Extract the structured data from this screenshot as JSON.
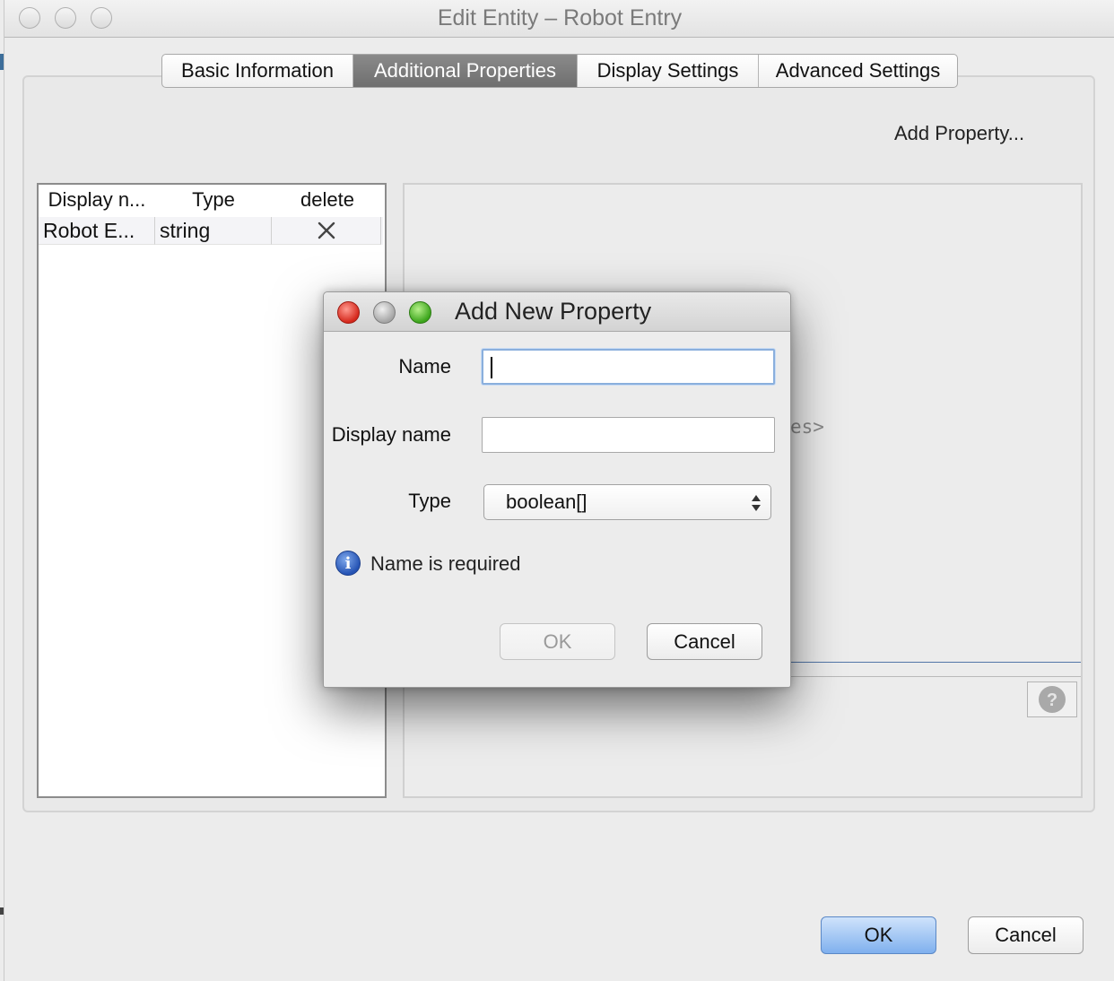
{
  "window": {
    "title": "Edit Entity – Robot Entry"
  },
  "tabs": [
    {
      "label": "Basic Information",
      "active": false
    },
    {
      "label": "Additional Properties",
      "active": true
    },
    {
      "label": "Display Settings",
      "active": false
    },
    {
      "label": "Advanced Settings",
      "active": false
    }
  ],
  "properties_panel": {
    "add_property_label": "Add Property...",
    "columns": [
      "Display n...",
      "Type",
      "delete"
    ],
    "rows": [
      {
        "display_name": "Robot E...",
        "type": "string",
        "delete_icon": "x-icon"
      }
    ],
    "details_hint_fragment": "es>"
  },
  "footer": {
    "ok_label": "OK",
    "cancel_label": "Cancel"
  },
  "dialog": {
    "title": "Add New Property",
    "name_label": "Name",
    "name_value": "",
    "display_name_label": "Display name",
    "display_name_value": "",
    "type_label": "Type",
    "type_value": "boolean[]",
    "message": "Name is required",
    "ok_label": "OK",
    "ok_enabled": false,
    "cancel_label": "Cancel"
  },
  "colors": {
    "active_tab": "#7d7d7d",
    "primary_button": "#7fb0ee",
    "focus_ring": "#8aafdd",
    "info_icon": "#2553b4"
  }
}
